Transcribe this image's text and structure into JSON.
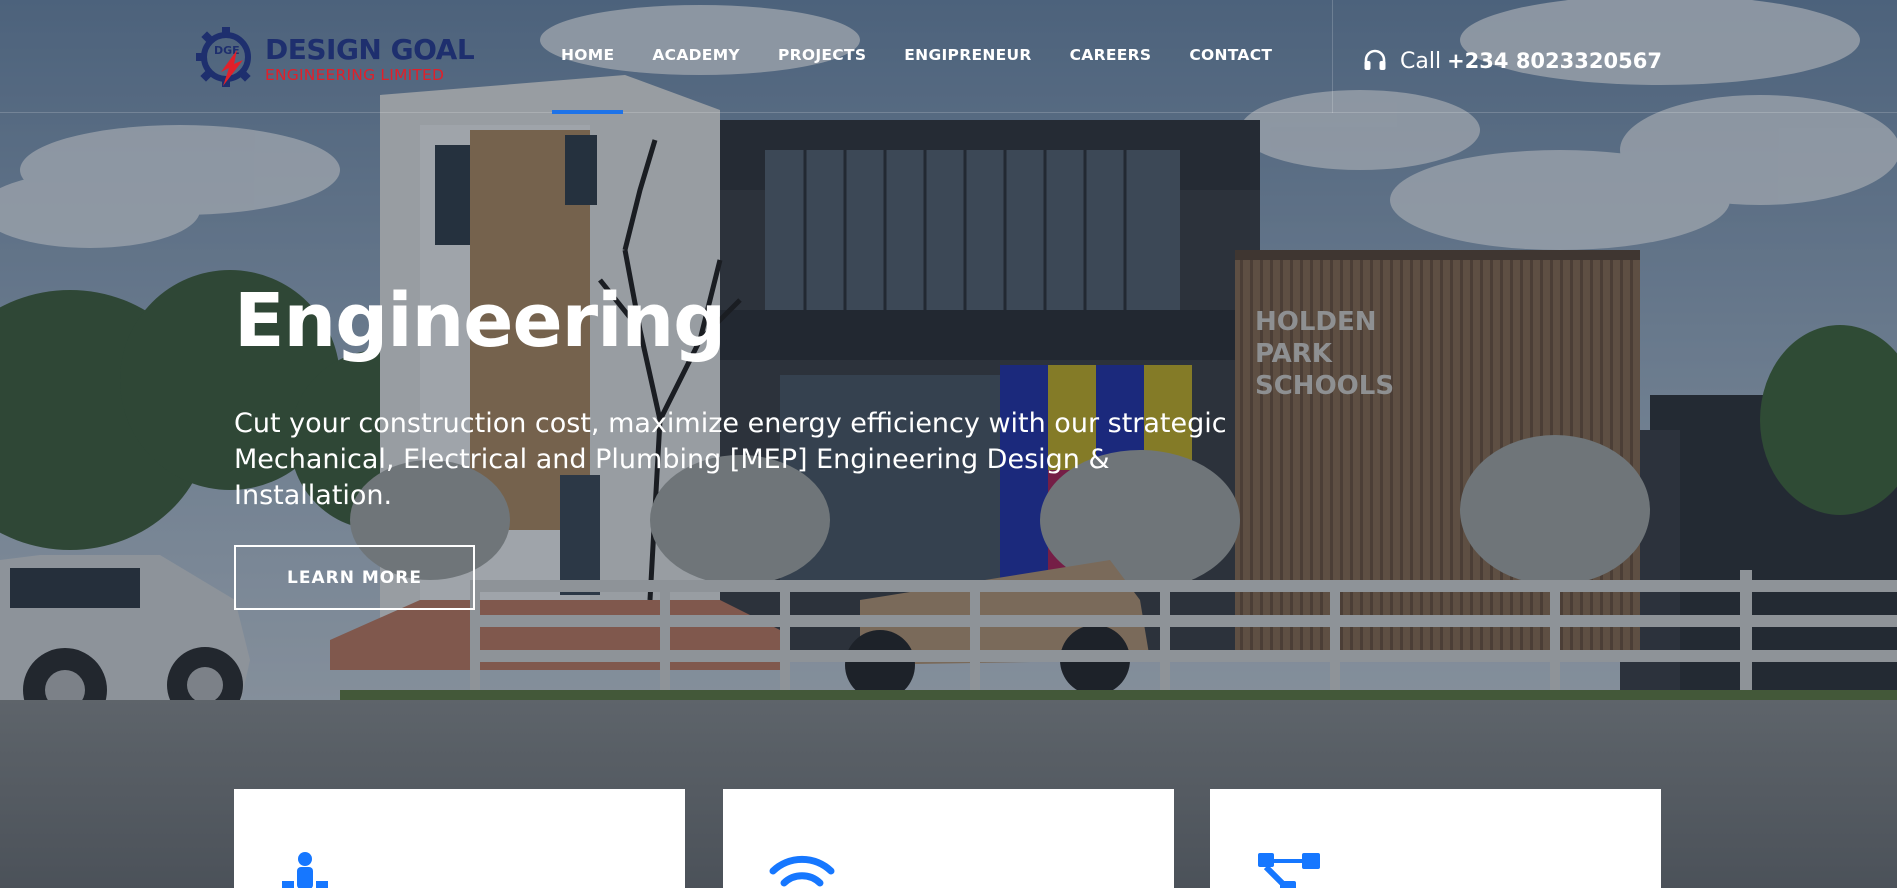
{
  "colors": {
    "accent": "#1e73e8",
    "logo_navy": "#1e2f6e",
    "logo_red": "#e0202a",
    "card_icon_blue": "#1677ff"
  },
  "logo": {
    "mark_text": "DGE",
    "title": "DESIGN GOAL",
    "subtitle": "ENGINEERING LIMITED"
  },
  "nav": {
    "items": [
      {
        "label": "HOME",
        "active": true
      },
      {
        "label": "ACADEMY",
        "active": false
      },
      {
        "label": "PROJECTS",
        "active": false
      },
      {
        "label": "ENGIPRENEUR",
        "active": false
      },
      {
        "label": "CAREERS",
        "active": false
      },
      {
        "label": "CONTACT",
        "active": false
      }
    ]
  },
  "call": {
    "icon": "headset-icon",
    "label": "Call",
    "number": "+234 8023320567"
  },
  "background": {
    "sign_text": "HOLDEN PARK SCHOOLS"
  },
  "hero": {
    "title": "Engineering",
    "description": "Cut your construction cost, maximize energy efficiency with our strategic Mechanical, Electrical and Plumbing [MEP] Engineering Design & Installation.",
    "cta_label": "LEARN MORE"
  },
  "cards": [
    {
      "icon": "person-network-icon"
    },
    {
      "icon": "wifi-icon"
    },
    {
      "icon": "hierarchy-icon"
    }
  ]
}
